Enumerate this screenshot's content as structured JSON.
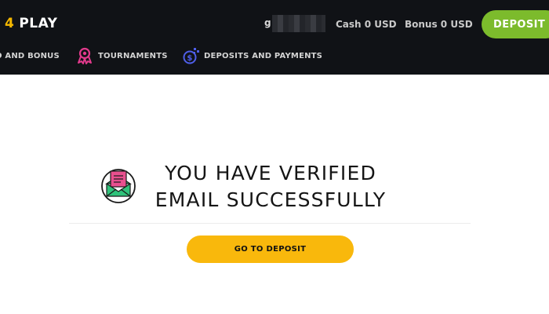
{
  "header": {
    "logo_number": "4",
    "logo_text": "PLAY",
    "user_partial": "g",
    "cash": "Cash 0 USD",
    "bonus": "Bonus 0 USD",
    "deposit_label": "DEPOSIT"
  },
  "nav": {
    "items": [
      {
        "label": "O AND BONUS",
        "icon": "bonus-icon"
      },
      {
        "label": "TOURNAMENTS",
        "icon": "ribbon-icon"
      },
      {
        "label": "DEPOSITS AND PAYMENTS",
        "icon": "coins-icon"
      }
    ]
  },
  "main": {
    "title_line1": "YOU HAVE VERIFIED",
    "title_line2": "EMAIL SUCCESSFULLY",
    "icon": "email-verified-icon",
    "button_label": "GO TO DEPOSIT"
  },
  "colors": {
    "header_bg": "#101216",
    "deposit_green": "#7cbb2c",
    "button_yellow": "#f9b80c",
    "logo_accent": "#f5b800"
  }
}
